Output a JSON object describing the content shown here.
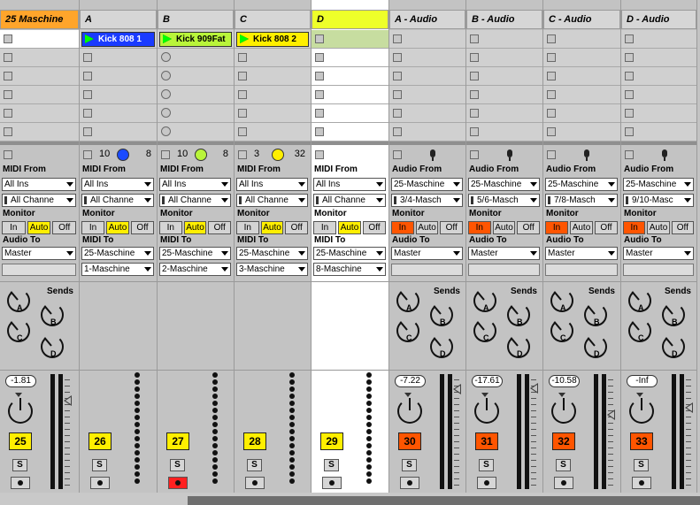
{
  "tracks": [
    {
      "name": "25 Maschine",
      "header_color": "#ffa52b",
      "kind": "midi",
      "slots": [
        "empty-white",
        "sq",
        "sq",
        "sq",
        "sq",
        "sq"
      ],
      "slot_clip": null,
      "status": {
        "n1": "",
        "n2": "",
        "dial": null
      },
      "from_label": "MIDI From",
      "from": "All Ins",
      "chan": "All Channe",
      "monitor": {
        "in": "In",
        "auto": "Auto",
        "off": "Off",
        "active": "auto"
      },
      "to_label": "Audio To",
      "to": "Master",
      "to2": null,
      "vol": "-1.81",
      "num": "25",
      "num_color": "#ffef00",
      "solo": "S",
      "arm": false,
      "meter": "bars",
      "sends": true
    },
    {
      "name": "A",
      "header_color": "#d6d6d6",
      "kind": "midi",
      "slots": [
        "clip",
        "sq",
        "sq",
        "sq",
        "sq",
        "sq"
      ],
      "slot_clip": {
        "label": "Kick 808 1",
        "color": "#1a3bff",
        "text": "#fff"
      },
      "status": {
        "n1": "10",
        "n2": "8",
        "dial": "#1a4bff"
      },
      "from_label": "MIDI From",
      "from": "All Ins",
      "chan": "All Channe",
      "monitor": {
        "in": "In",
        "auto": "Auto",
        "off": "Off",
        "active": "auto"
      },
      "to_label": "MIDI To",
      "to": "25-Maschine",
      "to2": "1-Maschine",
      "vol": null,
      "num": "26",
      "num_color": "#ffef00",
      "solo": "S",
      "arm": false,
      "meter": "dots",
      "sends": false
    },
    {
      "name": "B",
      "header_color": "#d6d6d6",
      "kind": "midi",
      "slots": [
        "clip",
        "ci",
        "ci",
        "ci",
        "ci",
        "ci"
      ],
      "slot_clip": {
        "label": "Kick 909Fat",
        "color": "#b9f53a",
        "text": "#000"
      },
      "status": {
        "n1": "10",
        "n2": "8",
        "dial": "#b9f53a"
      },
      "from_label": "MIDI From",
      "from": "All Ins",
      "chan": "All Channe",
      "monitor": {
        "in": "In",
        "auto": "Auto",
        "off": "Off",
        "active": "auto"
      },
      "to_label": "MIDI To",
      "to": "25-Maschine",
      "to2": "2-Maschine",
      "vol": null,
      "num": "27",
      "num_color": "#ffef00",
      "solo": "S",
      "arm": true,
      "meter": "dots",
      "sends": false
    },
    {
      "name": "C",
      "header_color": "#d6d6d6",
      "kind": "midi",
      "slots": [
        "clip",
        "sq",
        "sq",
        "sq",
        "sq",
        "sq"
      ],
      "slot_clip": {
        "label": "Kick 808 2",
        "color": "#ffef00",
        "text": "#000"
      },
      "status": {
        "n1": "3",
        "n2": "32",
        "dial": "#ffef00"
      },
      "from_label": "MIDI From",
      "from": "All Ins",
      "chan": "All Channe",
      "monitor": {
        "in": "In",
        "auto": "Auto",
        "off": "Off",
        "active": "auto"
      },
      "to_label": "MIDI To",
      "to": "25-Maschine",
      "to2": "3-Maschine",
      "vol": null,
      "num": "28",
      "num_color": "#ffef00",
      "solo": "S",
      "arm": false,
      "meter": "dots",
      "sends": false
    },
    {
      "name": "D",
      "header_color": "#eeff2a",
      "kind": "midi",
      "slots": [
        "green",
        "sq",
        "sq",
        "sq",
        "sq",
        "sq"
      ],
      "slot_clip": null,
      "status": {
        "n1": "",
        "n2": "",
        "dial": null
      },
      "from_label": "MIDI From",
      "from": "All Ins",
      "chan": "All Channe",
      "monitor": {
        "in": "In",
        "auto": "Auto",
        "off": "Off",
        "active": "auto"
      },
      "to_label": "MIDI To",
      "to": "25-Maschine",
      "to2": "8-Maschine",
      "vol": null,
      "num": "29",
      "num_color": "#ffef00",
      "solo": "S",
      "arm": false,
      "meter": "dots",
      "sends": false,
      "selected": true
    },
    {
      "name": "A - Audio",
      "header_color": "#d6d6d6",
      "kind": "audio",
      "slots": [
        "sq",
        "sq",
        "sq",
        "sq",
        "sq",
        "sq"
      ],
      "slot_clip": null,
      "status": {
        "n1": "",
        "n2": "",
        "dial": null,
        "mic": true
      },
      "from_label": "Audio From",
      "from": "25-Maschine",
      "chan": "3/4-Masch",
      "monitor": {
        "in": "In",
        "auto": "Auto",
        "off": "Off",
        "active": "in"
      },
      "to_label": "Audio To",
      "to": "Master",
      "to2": null,
      "vol": "-7.22",
      "num": "30",
      "num_color": "#ff5500",
      "solo": "S",
      "arm": false,
      "meter": "bars",
      "sends": true
    },
    {
      "name": "B - Audio",
      "header_color": "#d6d6d6",
      "kind": "audio",
      "slots": [
        "sq",
        "sq",
        "sq",
        "sq",
        "sq",
        "sq"
      ],
      "slot_clip": null,
      "status": {
        "n1": "",
        "n2": "",
        "dial": null,
        "mic": true
      },
      "from_label": "Audio From",
      "from": "25-Maschine",
      "chan": "5/6-Masch",
      "monitor": {
        "in": "In",
        "auto": "Auto",
        "off": "Off",
        "active": "in"
      },
      "to_label": "Audio To",
      "to": "Master",
      "to2": null,
      "vol": "-17.61",
      "num": "31",
      "num_color": "#ff5500",
      "solo": "S",
      "arm": false,
      "meter": "bars",
      "sends": true
    },
    {
      "name": "C - Audio",
      "header_color": "#d6d6d6",
      "kind": "audio",
      "slots": [
        "sq",
        "sq",
        "sq",
        "sq",
        "sq",
        "sq"
      ],
      "slot_clip": null,
      "status": {
        "n1": "",
        "n2": "",
        "dial": null,
        "mic": true
      },
      "from_label": "Audio From",
      "from": "25-Maschine",
      "chan": "7/8-Masch",
      "monitor": {
        "in": "In",
        "auto": "Auto",
        "off": "Off",
        "active": "in"
      },
      "to_label": "Audio To",
      "to": "Master",
      "to2": null,
      "vol": "-10.58",
      "num": "32",
      "num_color": "#ff5500",
      "solo": "S",
      "arm": false,
      "meter": "bars",
      "sends": true
    },
    {
      "name": "D - Audio",
      "header_color": "#d6d6d6",
      "kind": "audio",
      "slots": [
        "sq",
        "sq",
        "sq",
        "sq",
        "sq",
        "sq"
      ],
      "slot_clip": null,
      "status": {
        "n1": "",
        "n2": "",
        "dial": null,
        "mic": true
      },
      "from_label": "Audio From",
      "from": "25-Maschine",
      "chan": "9/10-Masc",
      "monitor": {
        "in": "In",
        "auto": "Auto",
        "off": "Off",
        "active": "in"
      },
      "to_label": "Audio To",
      "to": "Master",
      "to2": null,
      "vol": "-Inf",
      "num": "33",
      "num_color": "#ff5500",
      "solo": "S",
      "arm": false,
      "meter": "bars",
      "sends": true
    }
  ],
  "sends": {
    "label": "Sends",
    "knobs": [
      "A",
      "B",
      "C",
      "D"
    ]
  }
}
